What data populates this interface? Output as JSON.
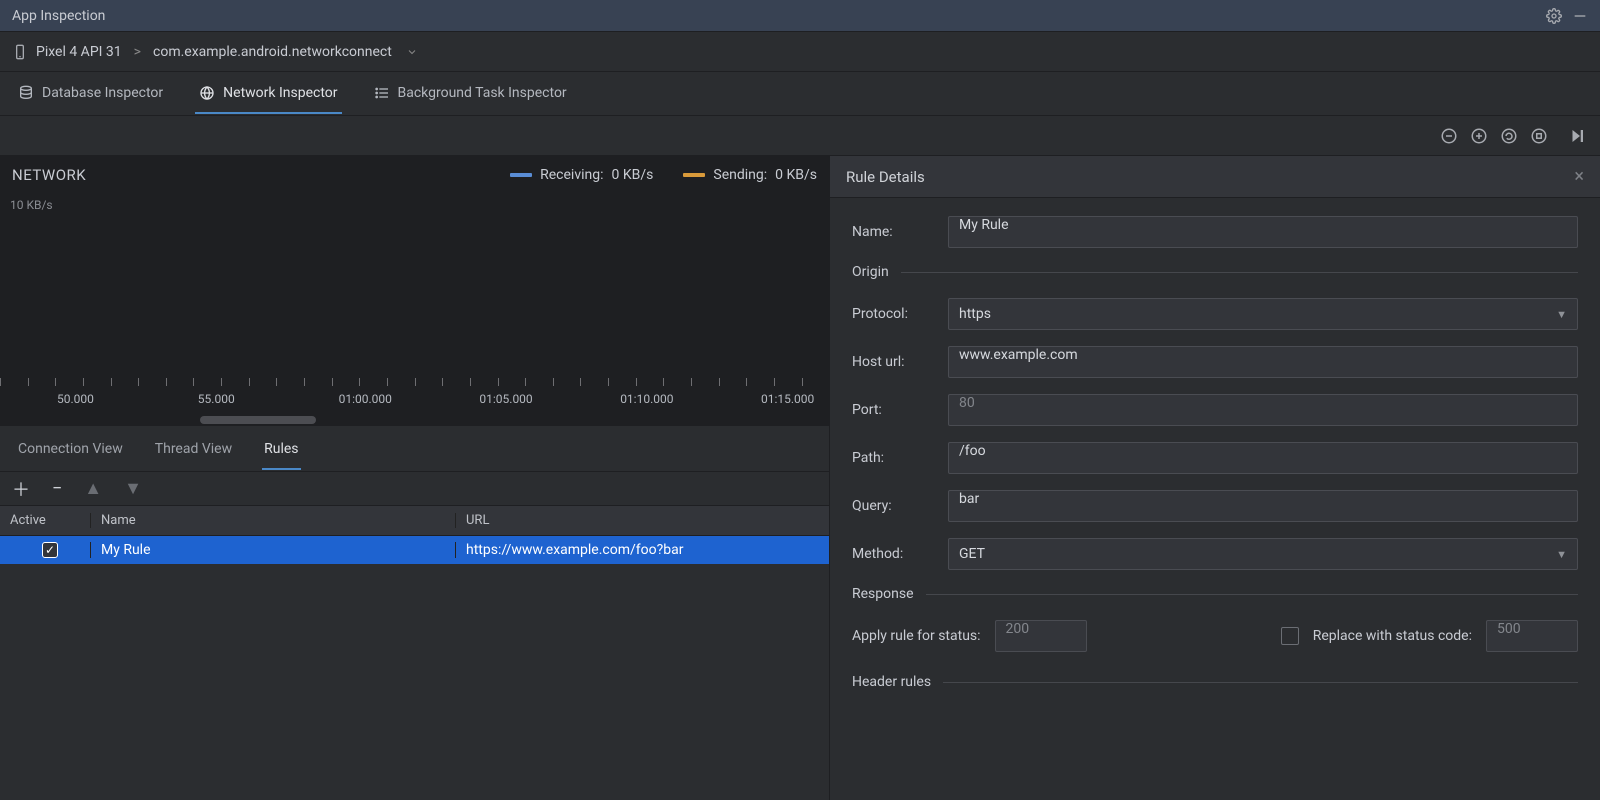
{
  "window": {
    "title": "App Inspection"
  },
  "breadcrumb": {
    "device": "Pixel 4 API 31",
    "process": "com.example.android.networkconnect"
  },
  "inspector_tabs": {
    "database": "Database Inspector",
    "network": "Network Inspector",
    "background": "Background Task Inspector",
    "active": "network"
  },
  "network_panel": {
    "title": "NETWORK",
    "y_label": "10 KB/s",
    "legend": {
      "receiving_label": "Receiving:",
      "receiving_value": "0 KB/s",
      "sending_label": "Sending:",
      "sending_value": "0 KB/s"
    },
    "timeline_ticks": [
      "50.000",
      "55.000",
      "01:00.000",
      "01:05.000",
      "01:10.000",
      "01:15.000"
    ]
  },
  "rules_tabs": {
    "connection": "Connection View",
    "thread": "Thread View",
    "rules": "Rules",
    "active": "rules"
  },
  "rules_table": {
    "headers": {
      "active": "Active",
      "name": "Name",
      "url": "URL"
    },
    "rows": [
      {
        "active": true,
        "name": "My Rule",
        "url": "https://www.example.com/foo?bar"
      }
    ]
  },
  "rule_details": {
    "panel_title": "Rule Details",
    "name_label": "Name:",
    "name_value": "My Rule",
    "origin_section": "Origin",
    "protocol_label": "Protocol:",
    "protocol_value": "https",
    "host_label": "Host url:",
    "host_value": "www.example.com",
    "port_label": "Port:",
    "port_placeholder": "80",
    "path_label": "Path:",
    "path_value": "/foo",
    "query_label": "Query:",
    "query_value": "bar",
    "method_label": "Method:",
    "method_value": "GET",
    "response_section": "Response",
    "apply_status_label": "Apply rule for status:",
    "apply_status_placeholder": "200",
    "replace_status_label": "Replace with status code:",
    "replace_status_placeholder": "500",
    "header_rules_section": "Header rules"
  }
}
